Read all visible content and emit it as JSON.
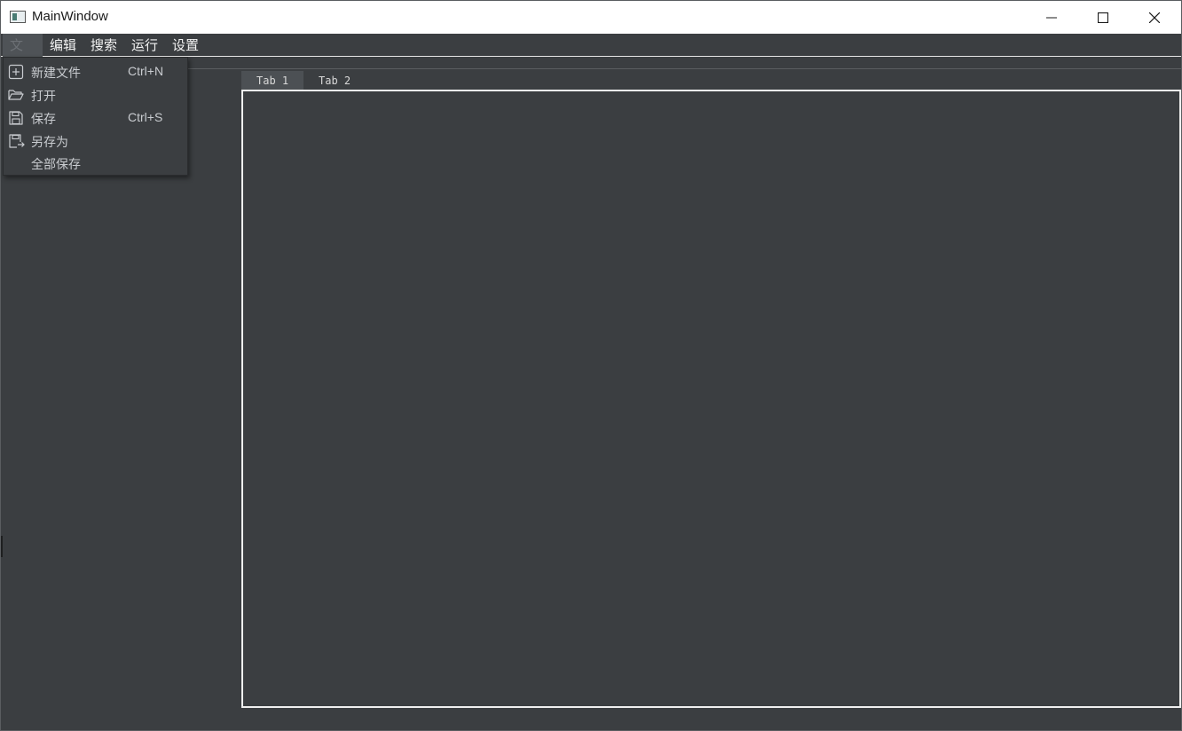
{
  "window": {
    "title": "MainWindow"
  },
  "menubar": {
    "items": [
      {
        "label": "文件"
      },
      {
        "label": "编辑"
      },
      {
        "label": "搜索"
      },
      {
        "label": "运行"
      },
      {
        "label": "设置"
      }
    ]
  },
  "file_menu": {
    "items": [
      {
        "label": "新建文件",
        "shortcut": "Ctrl+N",
        "icon": "new-file-icon"
      },
      {
        "label": "打开",
        "shortcut": "",
        "icon": "open-folder-icon"
      },
      {
        "label": "保存",
        "shortcut": "Ctrl+S",
        "icon": "save-icon"
      },
      {
        "label": "另存为",
        "shortcut": "",
        "icon": "save-as-icon"
      },
      {
        "label": "全部保存",
        "shortcut": "",
        "icon": ""
      }
    ]
  },
  "tabs": [
    {
      "label": "Tab 1",
      "active": true
    },
    {
      "label": "Tab 2",
      "active": false
    }
  ],
  "colors": {
    "background": "#3b3e41",
    "titlebar": "#ffffff",
    "menu_text": "#f2f2f2",
    "panel_border": "#f0f0f0"
  }
}
